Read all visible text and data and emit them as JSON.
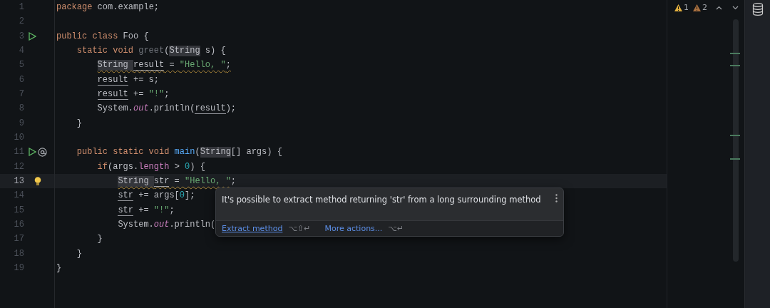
{
  "editor": {
    "lines": [
      {
        "number": "1",
        "current": false,
        "tokens": [
          {
            "text": "package",
            "kind": "kw"
          },
          {
            "text": " com.example;",
            "kind": "plain"
          }
        ]
      },
      {
        "number": "2",
        "current": false
      },
      {
        "number": "3",
        "current": false,
        "gutter_icons": [
          {
            "kind": "run"
          }
        ],
        "tokens": [
          {
            "text": "public class",
            "kind": "kw"
          },
          {
            "text": " Foo {",
            "kind": "plain"
          }
        ],
        "children": [
          {
            "number": "4",
            "current": false,
            "tokens": [
              {
                "text": "static void",
                "kind": "kw"
              },
              {
                "text": " greet",
                "kind": "unused"
              },
              {
                "text": "(",
                "kind": "plain"
              },
              {
                "text": "String",
                "kind": "plain",
                "highlight": true
              },
              {
                "text": " s) {",
                "kind": "plain"
              }
            ],
            "children": [
              {
                "number": "5",
                "current": false,
                "tokens": [
                  {
                    "text": "String ",
                    "kind": "plain",
                    "highlight": true,
                    "wavy": true
                  },
                  {
                    "text": "result",
                    "kind": "plain",
                    "underline": true,
                    "wavy": true
                  },
                  {
                    "text": " = ",
                    "kind": "plain",
                    "wavy": true
                  },
                  {
                    "text": "\"Hello, \"",
                    "kind": "str",
                    "wavy": true
                  },
                  {
                    "text": ";",
                    "kind": "plain",
                    "wavy": true
                  }
                ]
              },
              {
                "number": "6",
                "current": false,
                "tokens": [
                  {
                    "text": "result",
                    "kind": "plain",
                    "underline": true
                  },
                  {
                    "text": " += s;",
                    "kind": "plain"
                  }
                ]
              },
              {
                "number": "7",
                "current": false,
                "tokens": [
                  {
                    "text": "result",
                    "kind": "plain",
                    "underline": true
                  },
                  {
                    "text": " += ",
                    "kind": "plain"
                  },
                  {
                    "text": "\"!\"",
                    "kind": "str"
                  },
                  {
                    "text": ";",
                    "kind": "plain"
                  }
                ]
              },
              {
                "number": "8",
                "current": false,
                "tokens": [
                  {
                    "text": "System.",
                    "kind": "plain"
                  },
                  {
                    "text": "out",
                    "kind": "field"
                  },
                  {
                    "text": ".println(",
                    "kind": "plain"
                  },
                  {
                    "text": "result",
                    "kind": "plain",
                    "underline": true
                  },
                  {
                    "text": ");",
                    "kind": "plain"
                  }
                ]
              }
            ]
          },
          {
            "number": "9",
            "current": false,
            "tokens": [
              {
                "text": "}",
                "kind": "plain"
              }
            ]
          },
          {
            "number": "10",
            "current": false
          },
          {
            "number": "11",
            "current": false,
            "gutter_icons": [
              {
                "kind": "run"
              },
              {
                "kind": "at"
              }
            ],
            "tokens": [
              {
                "text": "public static void",
                "kind": "kw"
              },
              {
                "text": " main",
                "kind": "decl"
              },
              {
                "text": "(",
                "kind": "plain"
              },
              {
                "text": "String",
                "kind": "plain",
                "highlight": true
              },
              {
                "text": "[] args) {",
                "kind": "plain"
              }
            ],
            "children": [
              {
                "number": "12",
                "current": false,
                "tokens": [
                  {
                    "text": "if",
                    "kind": "kw"
                  },
                  {
                    "text": "(args.",
                    "kind": "plain"
                  },
                  {
                    "text": "length",
                    "kind": "member"
                  },
                  {
                    "text": " > ",
                    "kind": "plain"
                  },
                  {
                    "text": "0",
                    "kind": "num"
                  },
                  {
                    "text": ") {",
                    "kind": "plain"
                  }
                ],
                "children": [
                  {
                    "number": "13",
                    "current": true,
                    "gutter_icons": [
                      {
                        "kind": "bulb"
                      }
                    ],
                    "tokens": [
                      {
                        "text": "String ",
                        "kind": "plain",
                        "highlight": true,
                        "wavy": true
                      },
                      {
                        "text": "str",
                        "kind": "plain",
                        "underline": true,
                        "wavy": true
                      },
                      {
                        "text": " = ",
                        "kind": "plain",
                        "wavy": true
                      },
                      {
                        "text": "\"Hello, \"",
                        "kind": "str",
                        "wavy": true
                      },
                      {
                        "text": ";",
                        "kind": "plain"
                      }
                    ]
                  },
                  {
                    "number": "14",
                    "current": false,
                    "tokens": [
                      {
                        "text": "str",
                        "kind": "plain",
                        "underline": true
                      },
                      {
                        "text": " += args[",
                        "kind": "plain"
                      },
                      {
                        "text": "0",
                        "kind": "num"
                      },
                      {
                        "text": "];",
                        "kind": "plain"
                      }
                    ]
                  },
                  {
                    "number": "15",
                    "current": false,
                    "tokens": [
                      {
                        "text": "str",
                        "kind": "plain",
                        "underline": true
                      },
                      {
                        "text": " += ",
                        "kind": "plain"
                      },
                      {
                        "text": "\"!\"",
                        "kind": "str"
                      },
                      {
                        "text": ";",
                        "kind": "plain"
                      }
                    ]
                  },
                  {
                    "number": "16",
                    "current": false,
                    "tokens": [
                      {
                        "text": "System.",
                        "kind": "plain"
                      },
                      {
                        "text": "out",
                        "kind": "field"
                      },
                      {
                        "text": ".println(",
                        "kind": "plain"
                      }
                    ]
                  }
                ]
              },
              {
                "number": "17",
                "current": false,
                "tokens": [
                  {
                    "text": "}",
                    "kind": "plain"
                  }
                ]
              }
            ]
          },
          {
            "number": "18",
            "current": false,
            "tokens": [
              {
                "text": "}",
                "kind": "plain"
              }
            ]
          }
        ]
      },
      {
        "number": "19",
        "current": false,
        "tokens": [
          {
            "text": "}",
            "kind": "plain"
          }
        ]
      }
    ]
  },
  "inspections": [
    {
      "kind": "warning",
      "count": "1"
    },
    {
      "kind": "weak_warning",
      "count": "2"
    }
  ],
  "popup": {
    "message": "It's possible to extract method returning 'str' from a long surrounding method",
    "actions": [
      {
        "label": "Extract method",
        "shortcut": "⌥⇧↵"
      },
      {
        "label": "More actions...",
        "shortcut": "⌥↵"
      }
    ]
  }
}
